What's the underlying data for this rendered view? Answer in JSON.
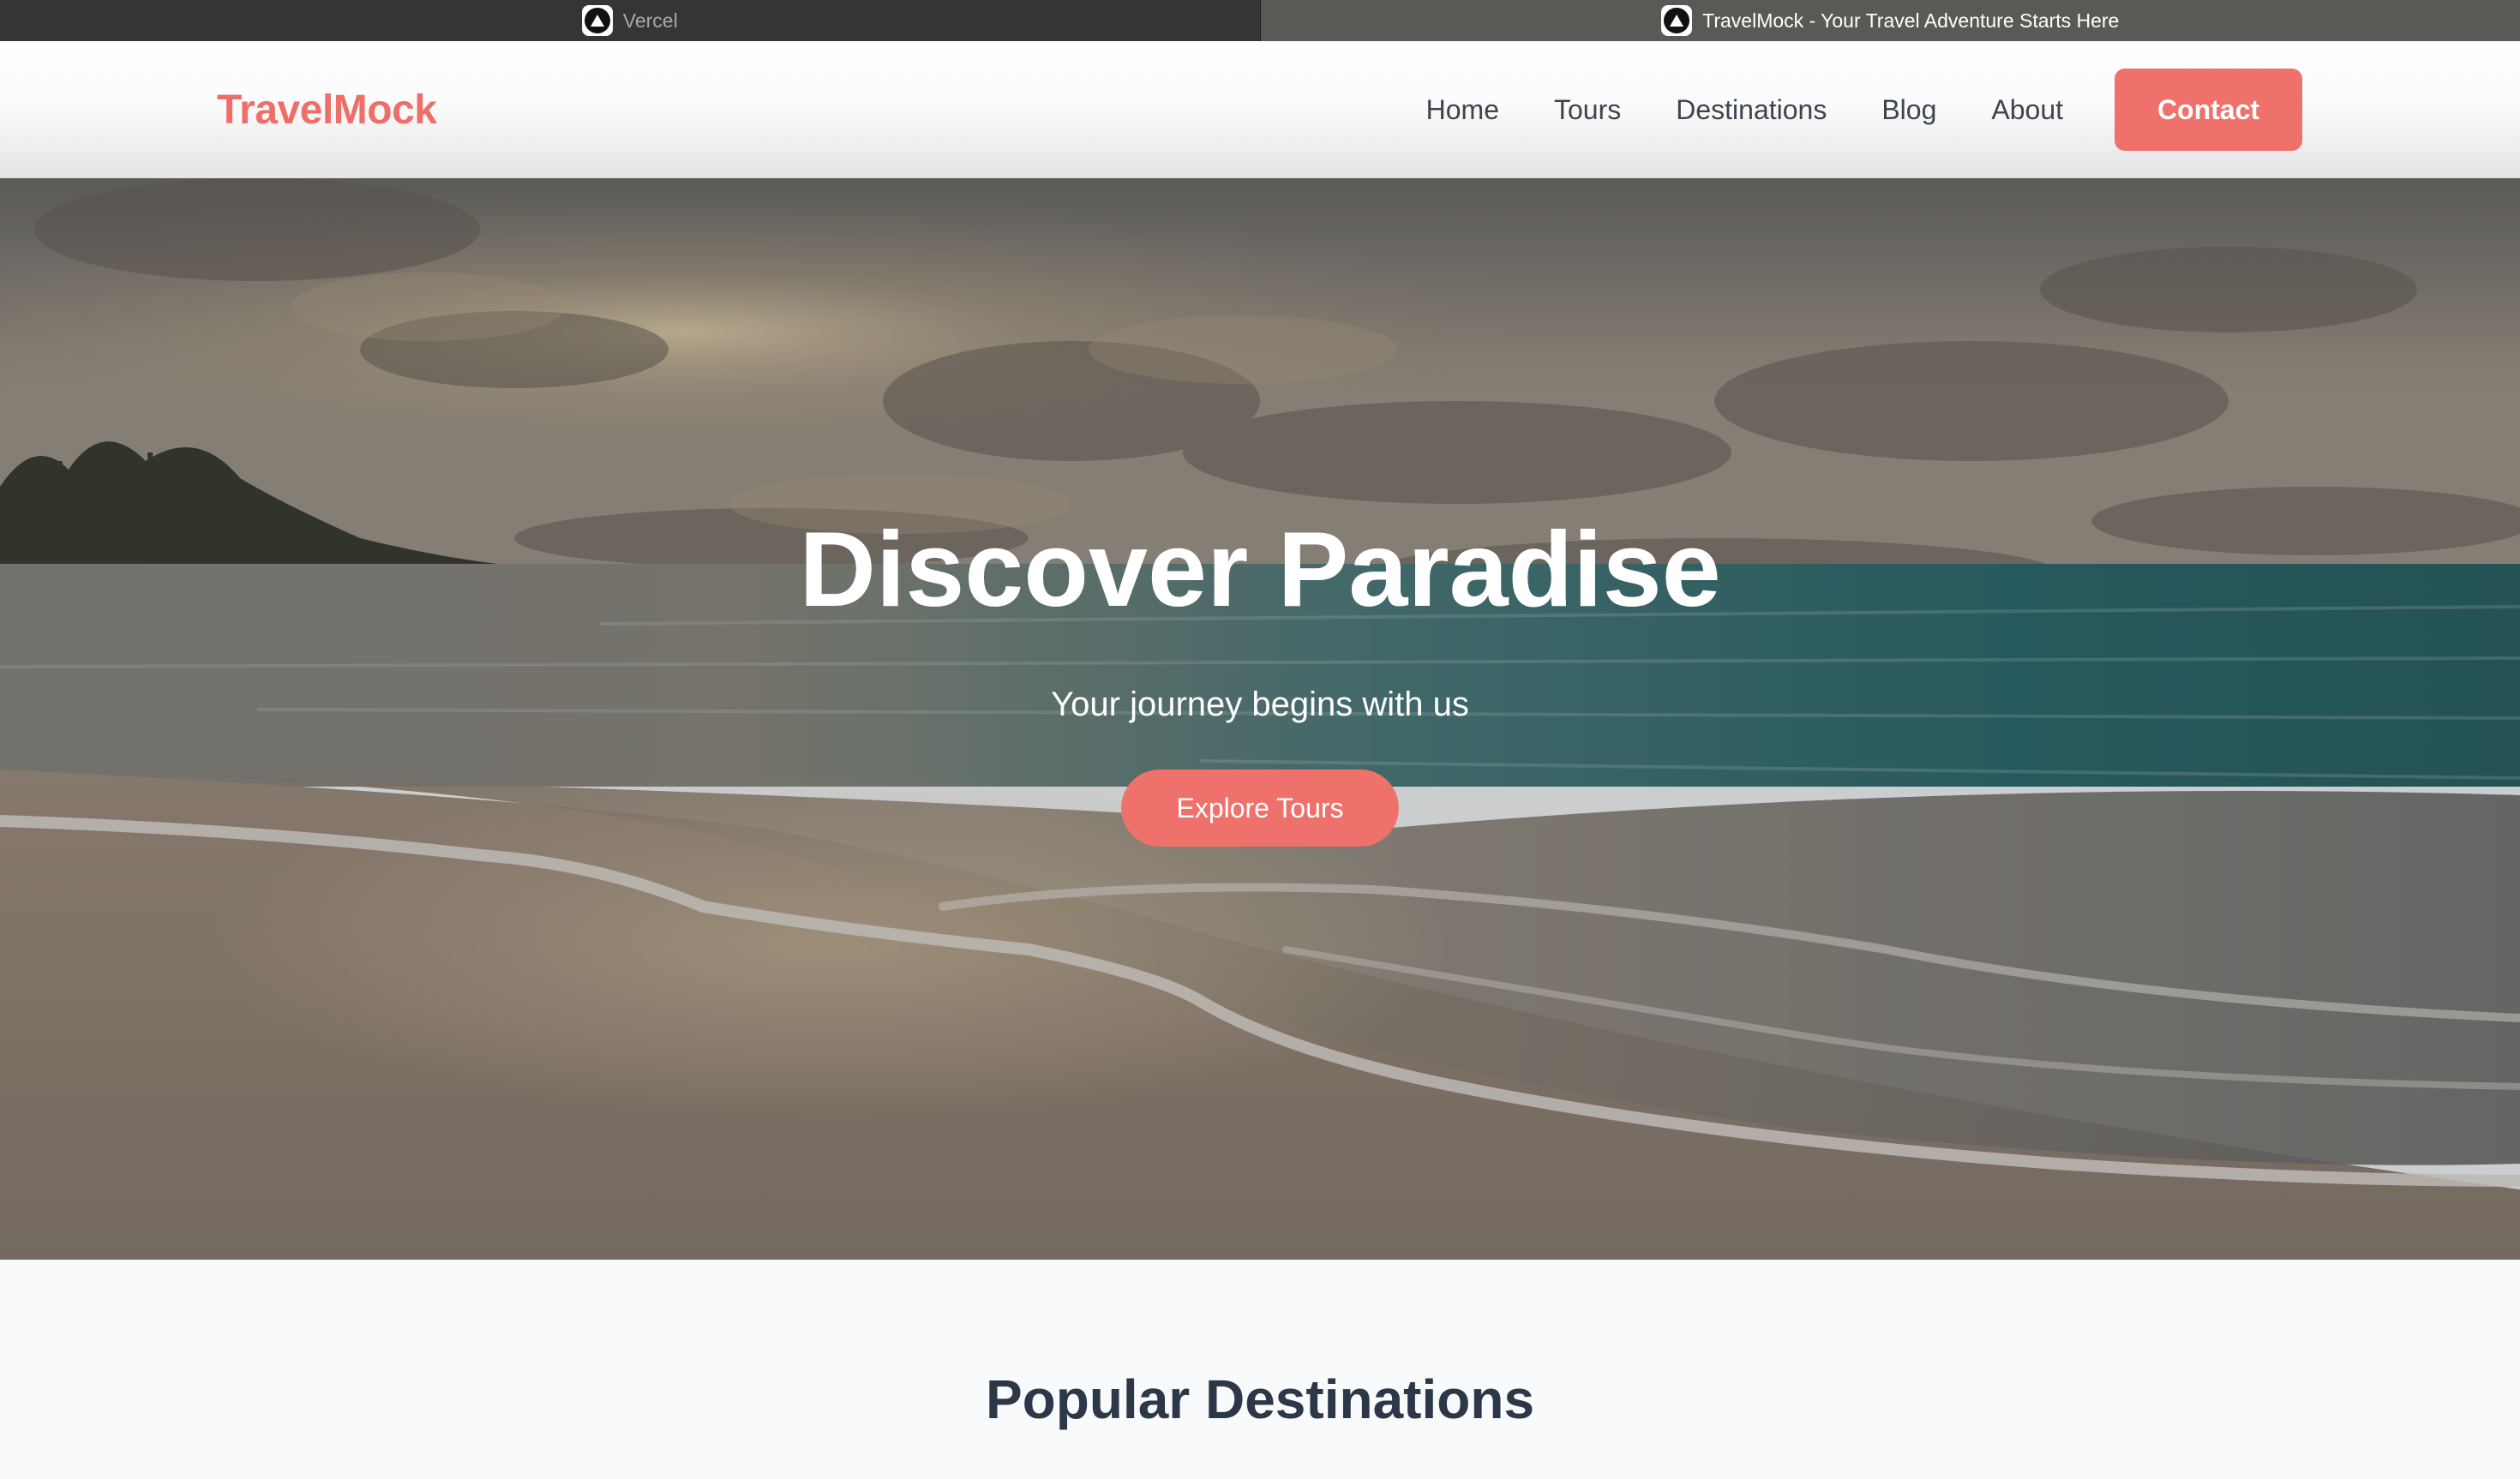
{
  "browser": {
    "tabs": [
      {
        "title": "Vercel",
        "icon": "vercel-icon",
        "active": false
      },
      {
        "title": "TravelMock - Your Travel Adventure Starts Here",
        "icon": "vercel-icon",
        "active": true
      }
    ]
  },
  "header": {
    "logo": "TravelMock",
    "nav": [
      {
        "label": "Home"
      },
      {
        "label": "Tours"
      },
      {
        "label": "Destinations"
      },
      {
        "label": "Blog"
      },
      {
        "label": "About"
      }
    ],
    "cta_label": "Contact"
  },
  "hero": {
    "title": "Discover Paradise",
    "subtitle": "Your journey begins with us",
    "cta_label": "Explore Tours",
    "background_icon": "beach-sunset-photo"
  },
  "popular": {
    "title": "Popular Destinations"
  },
  "colors": {
    "accent": "#ef716c",
    "heading": "#2c3848",
    "nav_text": "#3c4450",
    "section_bg": "#f8fafc"
  }
}
